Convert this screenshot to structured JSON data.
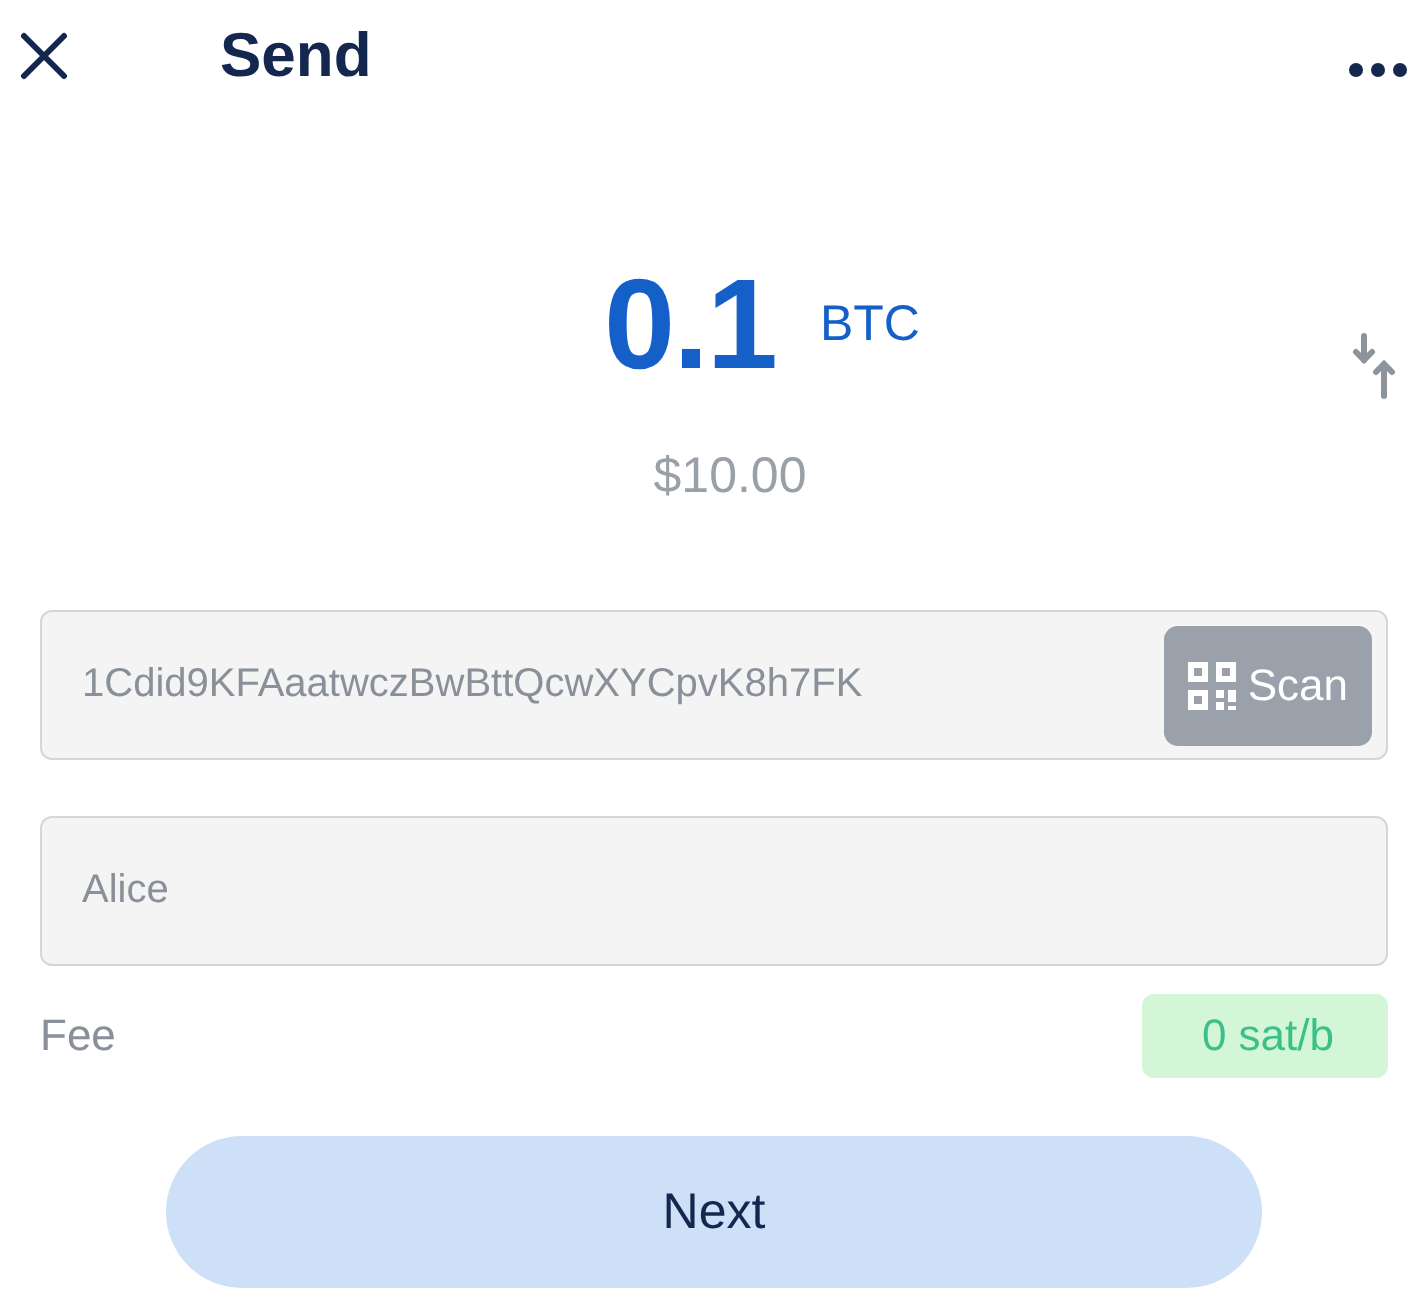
{
  "header": {
    "title": "Send"
  },
  "amount": {
    "value": "0.1",
    "unit": "BTC",
    "fiat": "$10.00"
  },
  "address_field": {
    "value": "1Cdid9KFAaatwczBwBttQcwXYCpvK8h7FK",
    "button": "Scan"
  },
  "label_field": {
    "value": "Alice"
  },
  "fee": {
    "label": "Fee",
    "value": "0 sat/b"
  },
  "next_button": {
    "label": "Next"
  }
}
